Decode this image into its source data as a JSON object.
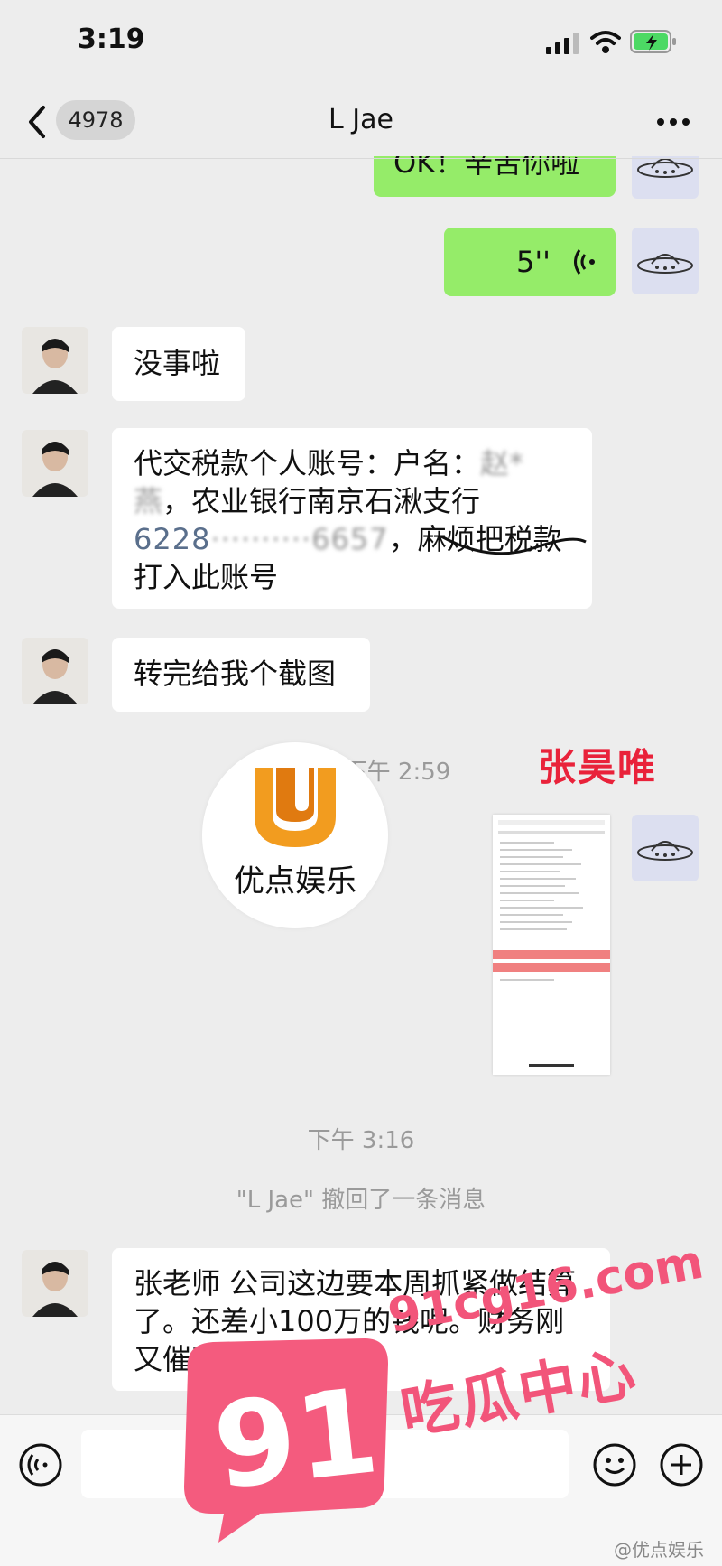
{
  "status": {
    "time": "3:19"
  },
  "nav": {
    "unread_count": "4978",
    "title": "L Jae"
  },
  "messages": {
    "sent_1": "OK！辛苦你啦",
    "sent_voice": "5''",
    "recv_1": "没事啦",
    "recv_2_line1": "代交税款个人账号：户名：",
    "recv_2_blur1": "赵*燕",
    "recv_2_line2": "，农业银行南京石湫支行",
    "recv_2_account": "6228",
    "recv_2_account_blur": "··········6657",
    "recv_2_line3": "，麻烦把税款打入此账号",
    "recv_3": "转完给我个截图",
    "recv_4": "张老师 公司这边要本周抓紧做结算了。还差小100万的钱呢。财务刚又催我了😂😂"
  },
  "timestamps": {
    "t1": "下午 2:59",
    "t2": "下午 3:16"
  },
  "system": {
    "recall": "\"L Jae\" 撤回了一条消息"
  },
  "overlays": {
    "logo_text": "优点娱乐",
    "red_caption": "张昊唯",
    "promo_badge": "91",
    "promo_url": "91cg16.com",
    "promo_title": "吃瓜中心",
    "weibo_mark": "@优点娱乐"
  },
  "colors": {
    "accent_green": "#95ec69",
    "watermark_red": "#e9223a",
    "promo_pink": "#f2557a"
  }
}
